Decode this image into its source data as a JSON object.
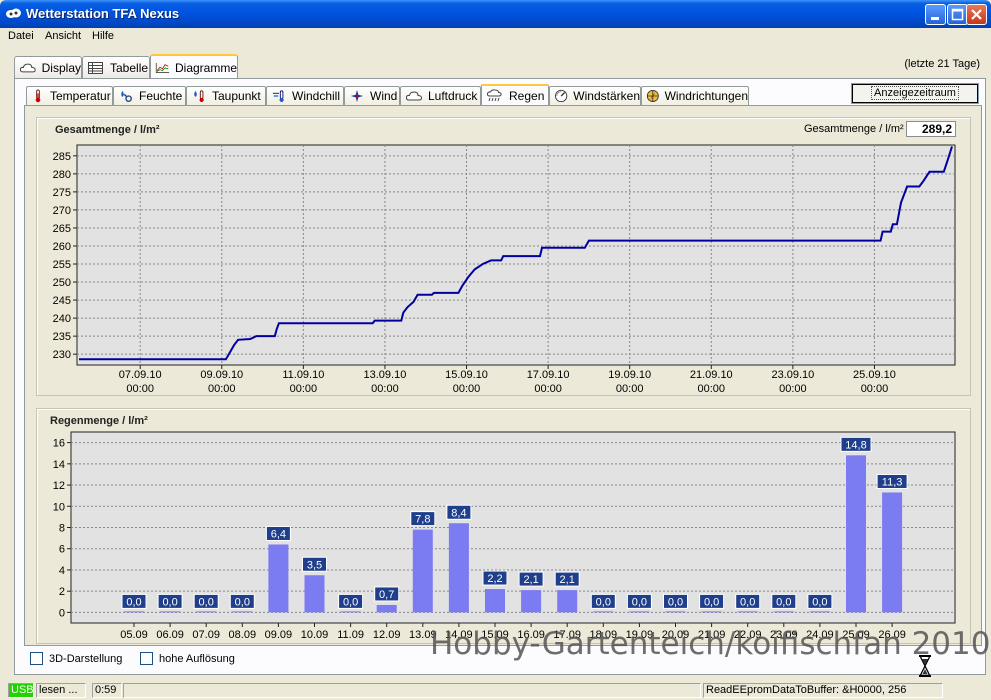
{
  "window": {
    "title": "Wetterstation TFA Nexus"
  },
  "menu": [
    "Datei",
    "Ansicht",
    "Hilfe"
  ],
  "main_tabs": [
    {
      "label": "Display",
      "icon": "cloud-icon"
    },
    {
      "label": "Tabelle",
      "icon": "table-icon"
    },
    {
      "label": "Diagramme",
      "icon": "chart-icon",
      "active": true
    }
  ],
  "range_label": "(letzte 21 Tage)",
  "sub_tabs": [
    {
      "label": "Temperatur",
      "icon": "thermometer-icon"
    },
    {
      "label": "Feuchte",
      "icon": "humidity-icon"
    },
    {
      "label": "Taupunkt",
      "icon": "dewpoint-icon"
    },
    {
      "label": "Windchill",
      "icon": "windchill-icon"
    },
    {
      "label": "Wind",
      "icon": "wind-icon"
    },
    {
      "label": "Luftdruck",
      "icon": "pressure-icon"
    },
    {
      "label": "Regen",
      "icon": "rain-icon",
      "active": true
    },
    {
      "label": "Windstärken",
      "icon": "windspeed-icon"
    },
    {
      "label": "Windrichtungen",
      "icon": "compass-icon"
    }
  ],
  "zeitraum_button": "Anzeigezeitraum",
  "total": {
    "label": "Gesamtmenge / l/m²",
    "value": "289,2"
  },
  "chart_data": [
    {
      "type": "line",
      "title": "Gesamtmenge / l/m²",
      "ylim": [
        227,
        288
      ],
      "yticks": [
        "230",
        "235",
        "240",
        "245",
        "250",
        "255",
        "260",
        "265",
        "270",
        "275",
        "280",
        "285"
      ],
      "xticks": [
        [
          "07.09.10",
          "00:00"
        ],
        [
          "09.09.10",
          "00:00"
        ],
        [
          "11.09.10",
          "00:00"
        ],
        [
          "13.09.10",
          "00:00"
        ],
        [
          "15.09.10",
          "00:00"
        ],
        [
          "17.09.10",
          "00:00"
        ],
        [
          "19.09.10",
          "00:00"
        ],
        [
          "21.09.10",
          "00:00"
        ],
        [
          "23.09.10",
          "00:00"
        ],
        [
          "25.09.10",
          "00:00"
        ]
      ],
      "x_start_label": "05.09.10 12:00",
      "points": [
        [
          0.0,
          228.6
        ],
        [
          3.6,
          228.6
        ],
        [
          3.7,
          230.5
        ],
        [
          3.8,
          232.5
        ],
        [
          3.9,
          234.0
        ],
        [
          4.2,
          234.2
        ],
        [
          4.35,
          235.0
        ],
        [
          4.8,
          235.0
        ],
        [
          4.85,
          237.0
        ],
        [
          4.9,
          238.6
        ],
        [
          7.2,
          238.6
        ],
        [
          7.25,
          239.3
        ],
        [
          7.9,
          239.3
        ],
        [
          7.95,
          241.5
        ],
        [
          8.05,
          243.0
        ],
        [
          8.2,
          244.5
        ],
        [
          8.3,
          246.5
        ],
        [
          8.65,
          246.5
        ],
        [
          8.7,
          247.0
        ],
        [
          9.3,
          247.0
        ],
        [
          9.4,
          249.0
        ],
        [
          9.55,
          251.5
        ],
        [
          9.7,
          253.5
        ],
        [
          9.9,
          255.0
        ],
        [
          10.1,
          256.0
        ],
        [
          10.35,
          256.0
        ],
        [
          10.4,
          257.2
        ],
        [
          11.3,
          257.2
        ],
        [
          11.35,
          259.5
        ],
        [
          12.4,
          259.5
        ],
        [
          12.5,
          261.5
        ],
        [
          19.65,
          261.5
        ],
        [
          19.7,
          264.0
        ],
        [
          19.9,
          264.0
        ],
        [
          19.95,
          266.0
        ],
        [
          20.05,
          266.0
        ],
        [
          20.15,
          272.0
        ],
        [
          20.3,
          276.5
        ],
        [
          20.6,
          276.5
        ],
        [
          20.7,
          278.0
        ],
        [
          20.85,
          280.6
        ],
        [
          21.2,
          280.6
        ],
        [
          21.3,
          284.0
        ],
        [
          21.4,
          287.6
        ]
      ],
      "x_days": 21.45
    },
    {
      "type": "bar",
      "title": "Regenmenge / l/m²",
      "ylim": [
        -1,
        17
      ],
      "yticks": [
        "0",
        "2",
        "4",
        "6",
        "8",
        "10",
        "12",
        "14",
        "16"
      ],
      "categories": [
        "05.09",
        "06.09",
        "07.09",
        "08.09",
        "09.09",
        "10.09",
        "11.09",
        "12.09",
        "13.09",
        "14.09",
        "15.09",
        "16.09",
        "17.09",
        "18.09",
        "19.09",
        "20.09",
        "21.09",
        "22.09",
        "23.09",
        "24.09",
        "25.09",
        "26.09"
      ],
      "values": [
        0.0,
        0.0,
        0.0,
        0.0,
        6.4,
        3.5,
        0.0,
        0.7,
        7.8,
        8.4,
        2.2,
        2.1,
        2.1,
        0.0,
        0.0,
        0.0,
        0.0,
        0.0,
        0.0,
        0.0,
        14.8,
        11.3
      ],
      "labels": [
        "0,0",
        "0,0",
        "0,0",
        "0,0",
        "6,4",
        "3,5",
        "0,0",
        "0,7",
        "7,8",
        "8,4",
        "2,2",
        "2,1",
        "2,1",
        "0,0",
        "0,0",
        "0,0",
        "0,0",
        "0,0",
        "0,0",
        "0,0",
        "14,8",
        "11,3"
      ]
    }
  ],
  "checkboxes": [
    {
      "label": "3D-Darstellung",
      "checked": false
    },
    {
      "label": "hohe Auflösung",
      "checked": false
    }
  ],
  "watermark": "Hobby-Gartenteich/koifischfan 2010",
  "status": {
    "usb": "USB",
    "mode": "lesen ...",
    "time": "0:59",
    "message": "ReadEEpromDataToBuffer: &H0000, 256"
  },
  "colors": {
    "line": "#0000a0",
    "bar": "#7b7bf2",
    "label_bg": "#1f3f8c",
    "plot_bg": "#e2e2e2"
  }
}
